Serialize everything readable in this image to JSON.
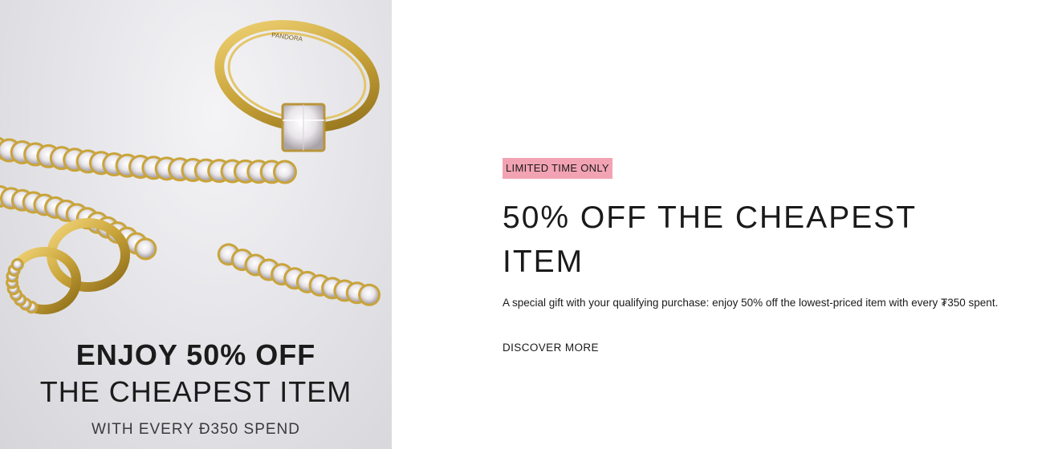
{
  "image": {
    "subject": "gold tennis bracelets, engagement ring and hoop earrings",
    "engraving": "PANDORA",
    "caption": {
      "line1": "ENJOY 50% OFF",
      "line2": "THE CHEAPEST ITEM",
      "line3": "WITH EVERY Ɖ350 SPEND"
    }
  },
  "promo": {
    "badge": "LIMITED TIME ONLY",
    "headline": "50% OFF THE CHEAPEST ITEM",
    "description": "A special gift with your qualifying purchase: enjoy 50% off the lowest-priced item with every ₮350 spent.",
    "cta": "DISCOVER MORE"
  },
  "colors": {
    "badge_bg": "#f2a3b3",
    "gold": "#c9a43a",
    "text": "#1a1a1a"
  }
}
